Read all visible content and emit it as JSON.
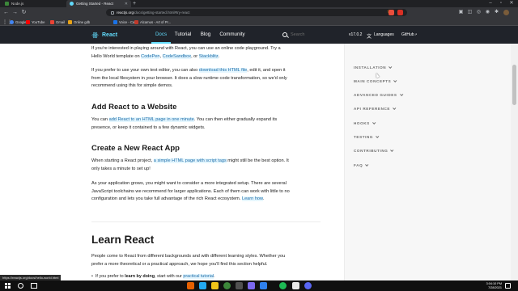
{
  "browser": {
    "tabs": [
      {
        "title": "Node.js"
      },
      {
        "title": "Getting Started - React"
      }
    ],
    "url_prefix": "reactjs.org",
    "url_path": "/docs/getting-started.html#try-react",
    "bookmarks": [
      {
        "label": "Google",
        "color": "#4285f4"
      },
      {
        "label": "YouTube",
        "color": "#ff0000"
      },
      {
        "label": "Gmail",
        "color": "#ea4335"
      },
      {
        "label": "Online gdb",
        "color": "#e8a317"
      },
      {
        "label": "Voice - Calls",
        "color": "#1a73e8"
      },
      {
        "label": "Alcamus - Art of Pr...",
        "color": "#c0392b"
      }
    ],
    "status_url": "https://reactjs.org/docs/hello-world.html"
  },
  "site": {
    "logo_text": "React",
    "nav": [
      {
        "label": "Docs",
        "active": true
      },
      {
        "label": "Tutorial",
        "active": false
      },
      {
        "label": "Blog",
        "active": false
      },
      {
        "label": "Community",
        "active": false
      }
    ],
    "search_placeholder": "Search",
    "version": "v17.0.2",
    "languages": "Languages",
    "github": "GitHub"
  },
  "content": {
    "p1": {
      "pre": "If you're interested in playing around with React, you can use an online code playground. Try a Hello World template on ",
      "link1": "CodePen",
      "sep1": ", ",
      "link2": "CodeSandbox",
      "sep2": ", or ",
      "link3": "Stackblitz",
      "post": "."
    },
    "p2": {
      "pre": "If you prefer to use your own text editor, you can also ",
      "link": "download this HTML file",
      "post": ", edit it, and open it from the local filesystem in your browser. It does a slow runtime code transformation, so we'd only recommend using this for simple demos."
    },
    "h_add": "Add React to a Website",
    "p3": {
      "pre": "You can ",
      "link": "add React to an HTML page in one minute",
      "post": ". You can then either gradually expand its presence, or keep it contained to a few dynamic widgets."
    },
    "h_create": "Create a New React App",
    "p4": {
      "pre": "When starting a React project, ",
      "link": "a simple HTML page with script tags",
      "post": " might still be the best option. It only takes a minute to set up!"
    },
    "p5": {
      "pre": "As your application grows, you might want to consider a more integrated setup. There are several JavaScript toolchains we recommend for larger applications. Each of them can work with little to no configuration and lets you take full advantage of the rich React ecosystem. ",
      "link": "Learn how",
      "post": "."
    },
    "h_learn": "Learn React",
    "p6": "People come to React from different backgrounds and with different learning styles. Whether you prefer a more theoretical or a practical approach, we hope you'll find this section helpful.",
    "bullet": {
      "pre": "If you prefer to ",
      "strong": "learn by doing",
      "mid": ", start with our ",
      "link": "practical tutorial",
      "post": "."
    }
  },
  "sidebar": {
    "items": [
      {
        "label": "INSTALLATION"
      },
      {
        "label": "MAIN CONCEPTS"
      },
      {
        "label": "ADVANCED GUIDES"
      },
      {
        "label": "API REFERENCE"
      },
      {
        "label": "HOOKS"
      },
      {
        "label": "TESTING"
      },
      {
        "label": "CONTRIBUTING"
      },
      {
        "label": "FAQ"
      }
    ]
  },
  "taskbar": {
    "time": "3:04:10 PM",
    "date": "7/28/2021"
  }
}
